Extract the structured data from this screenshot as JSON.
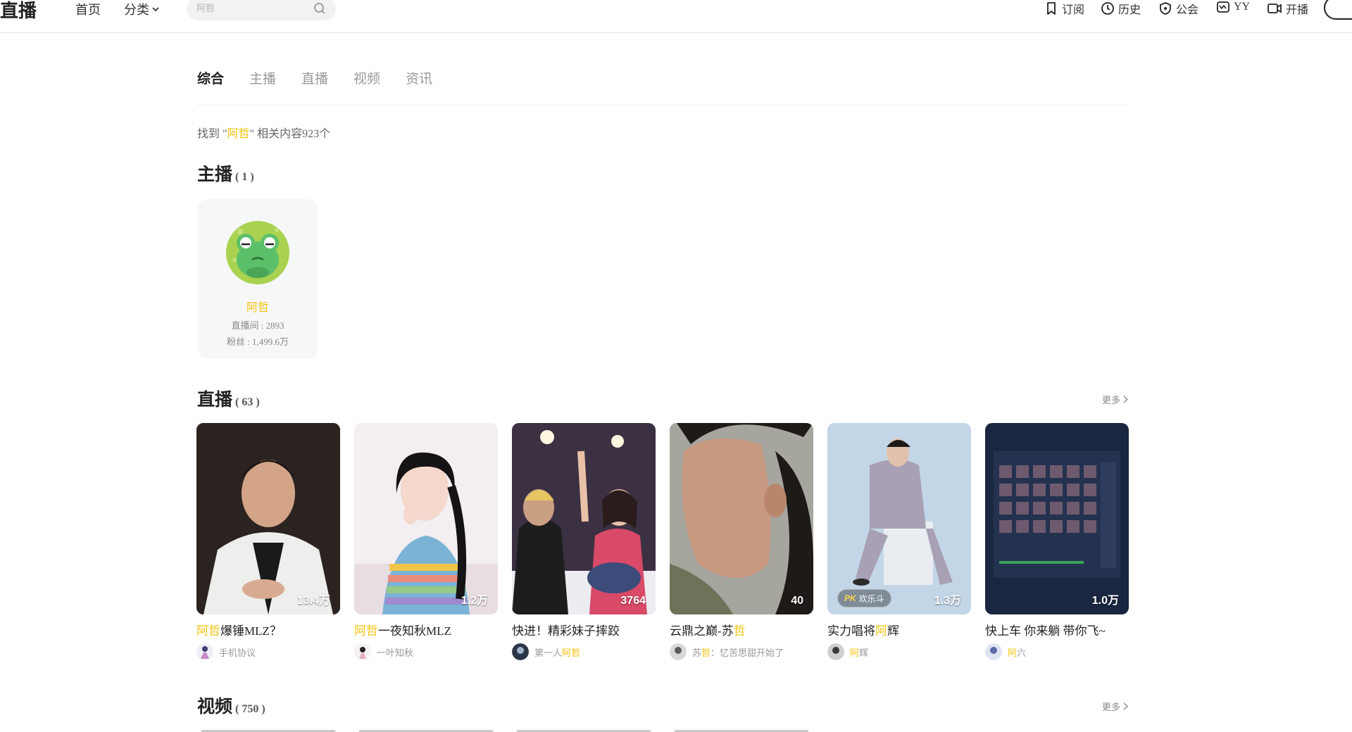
{
  "header": {
    "logo": "直播",
    "nav_home": "首页",
    "nav_category": "分类",
    "search_placeholder": "阿哲",
    "right_nav": [
      {
        "label": "订阅",
        "icon": "bookmark-icon"
      },
      {
        "label": "历史",
        "icon": "clock-icon"
      },
      {
        "label": "公会",
        "icon": "shield-icon"
      },
      {
        "label": "YY",
        "icon": "yy-icon"
      },
      {
        "label": "开播",
        "icon": "camera-icon"
      }
    ]
  },
  "tabs": [
    "综合",
    "主播",
    "直播",
    "视频",
    "资讯"
  ],
  "active_tab": "综合",
  "result": {
    "prefix": "找到 \"",
    "keyword": "阿哲",
    "suffix": "\" 相关内容923个"
  },
  "sections": {
    "anchors": {
      "title": "主播",
      "count": "( 1 )"
    },
    "live": {
      "title": "直播",
      "count": "( 63 )",
      "more": "更多"
    },
    "video": {
      "title": "视频",
      "count": "( 750 )",
      "more": "更多"
    }
  },
  "anchor": {
    "name": "阿哲",
    "room": "直播间 : 2893",
    "fans": "粉丝 : 1,499.6万"
  },
  "live_cards": [
    {
      "title_hl": "阿哲",
      "title_rest": "爆锤MLZ？",
      "viewers": "13.4万",
      "sub_pre": "",
      "sub_hl": "",
      "sub_post": "手机协议",
      "bg": [
        "#e9e7e4",
        "#3a2f2a"
      ]
    },
    {
      "title_hl": "阿哲",
      "title_rest": "一夜知秋MLZ",
      "viewers": "1.2万",
      "sub_pre": "",
      "sub_hl": "",
      "sub_post": "一叶知秋",
      "bg": [
        "#f4eef1",
        "#b7a0a6"
      ]
    },
    {
      "title_pre": "快进！精彩妹子摔跤",
      "viewers": "3764",
      "sub_pre": "第一人",
      "sub_hl": "阿哲",
      "sub_post": "",
      "bg": [
        "#c9a79a",
        "#4a3b55"
      ]
    },
    {
      "title_pre": "云鼎之巅-苏",
      "title_hl2": "哲",
      "viewers": "40",
      "sub_pre": "苏",
      "sub_hl": "哲",
      "sub_post": "：忆苦思甜开始了",
      "bg": [
        "#8a8c86",
        "#3c3934"
      ]
    },
    {
      "title_pre": "实力唱将",
      "title_hl2": "阿",
      "title_post": "辉",
      "viewers": "1.3万",
      "badge": "欢乐斗",
      "badge_pk": "PK",
      "sub_pre": "",
      "sub_hl": "阿",
      "sub_post": "辉",
      "bg": [
        "#bfd2e4",
        "#8ea9c4"
      ]
    },
    {
      "title_pre": "快上车 你来躺 带你飞~",
      "viewers": "1.0万",
      "sub_pre": "",
      "sub_hl": "阿",
      "sub_post": "六",
      "bg": [
        "#2d3e5e",
        "#16202f"
      ]
    }
  ]
}
